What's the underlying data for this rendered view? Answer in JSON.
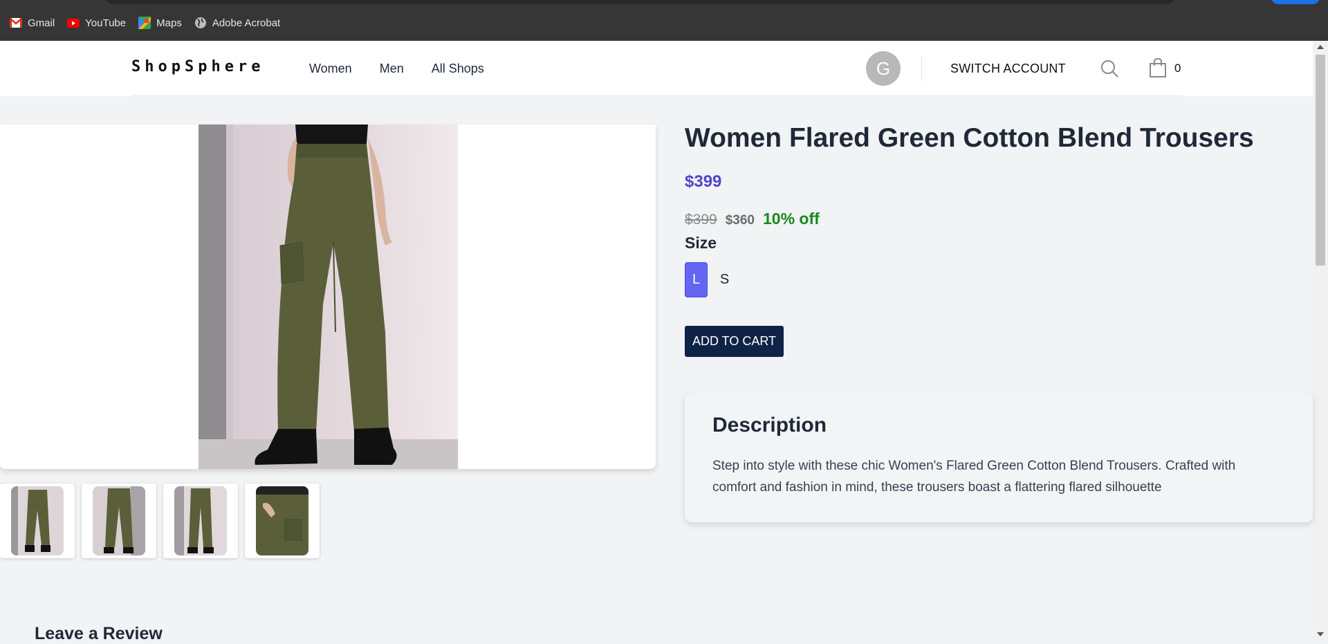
{
  "browser": {
    "bookmarks": [
      {
        "label": "Gmail",
        "icon": "gmail-icon"
      },
      {
        "label": "YouTube",
        "icon": "youtube-icon"
      },
      {
        "label": "Maps",
        "icon": "maps-icon"
      },
      {
        "label": "Adobe Acrobat",
        "icon": "globe-icon"
      }
    ]
  },
  "header": {
    "logo": "ShopSphere",
    "nav": [
      "Women",
      "Men",
      "All Shops"
    ],
    "avatar_initial": "G",
    "switch_account": "SWITCH ACCOUNT",
    "cart_count": "0"
  },
  "product": {
    "title": "Women Flared Green Cotton Blend Trousers",
    "price": "$399",
    "original_price": "$399",
    "sale_price": "$360",
    "discount": "10% off",
    "size_label": "Size",
    "sizes": [
      "L",
      "S"
    ],
    "selected_size": "L",
    "add_to_cart": "ADD TO CART",
    "thumbnail_count": 4
  },
  "description": {
    "title": "Description",
    "text": "Step into style with these chic Women's Flared Green Cotton Blend Trousers. Crafted with comfort and fashion in mind, these trousers boast a flattering flared silhouette"
  },
  "review": {
    "title": "Leave a Review"
  },
  "colors": {
    "accent": "#6366f1",
    "price": "#5046c8",
    "discount": "#18881e",
    "button": "#0f2347"
  }
}
